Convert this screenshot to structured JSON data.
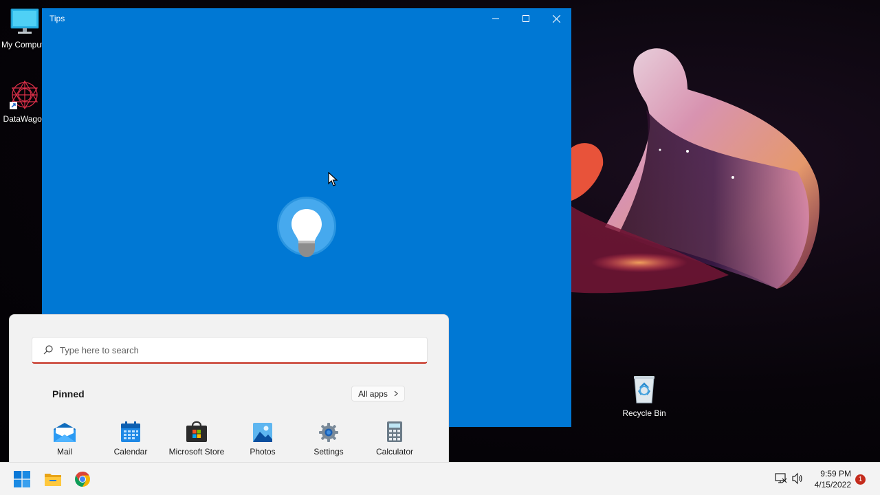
{
  "desktop": {
    "icons": [
      {
        "label": "My Compute"
      },
      {
        "label": "DataWagon"
      },
      {
        "label": "Recycle Bin"
      }
    ]
  },
  "tips_window": {
    "title": "Tips"
  },
  "start_menu": {
    "search": {
      "placeholder": "Type here to search"
    },
    "pinned_label": "Pinned",
    "all_apps_label": "All apps",
    "pinned_apps": [
      {
        "label": "Mail",
        "icon": "mail-icon"
      },
      {
        "label": "Calendar",
        "icon": "calendar-icon"
      },
      {
        "label": "Microsoft Store",
        "icon": "store-icon"
      },
      {
        "label": "Photos",
        "icon": "photos-icon"
      },
      {
        "label": "Settings",
        "icon": "settings-icon"
      },
      {
        "label": "Calculator",
        "icon": "calculator-icon"
      }
    ]
  },
  "taskbar": {
    "apps": [
      "start-icon",
      "file-explorer-icon",
      "chrome-icon"
    ],
    "clock": {
      "time": "9:59 PM",
      "date": "4/15/2022"
    },
    "notification_count": "1"
  },
  "colors": {
    "tips_blue": "#0078d4",
    "search_accent": "#c42b1c"
  }
}
